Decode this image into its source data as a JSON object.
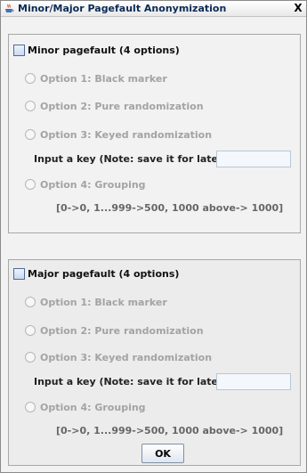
{
  "window": {
    "title": "Minor/Major Pagefault Anonymization",
    "close_label": "X"
  },
  "minor": {
    "header": "Minor pagefault (4 options)",
    "option1": "Option 1: Black marker",
    "option2": "Option 2: Pure randomization",
    "option3": "Option 3: Keyed randomization",
    "key_label": "Input a key (Note: save it for later use):",
    "key_value": "",
    "option4": "Option 4: Grouping",
    "mapping": "[0->0, 1...999->500, 1000 above-> 1000]"
  },
  "major": {
    "header": "Major pagefault (4 options)",
    "option1": "Option 1: Black marker",
    "option2": "Option 2: Pure randomization",
    "option3": "Option 3: Keyed randomization",
    "key_label": "Input a key (Note: save it for later use):",
    "key_value": "",
    "option4": "Option 4: Grouping",
    "mapping": "[0->0, 1...999->500, 1000 above-> 1000]"
  },
  "ok_label": "OK",
  "colors": {
    "disabled_text": "#a3a3a3",
    "title_text": "#0b2a55",
    "checkbox_border": "#4c6b99"
  }
}
